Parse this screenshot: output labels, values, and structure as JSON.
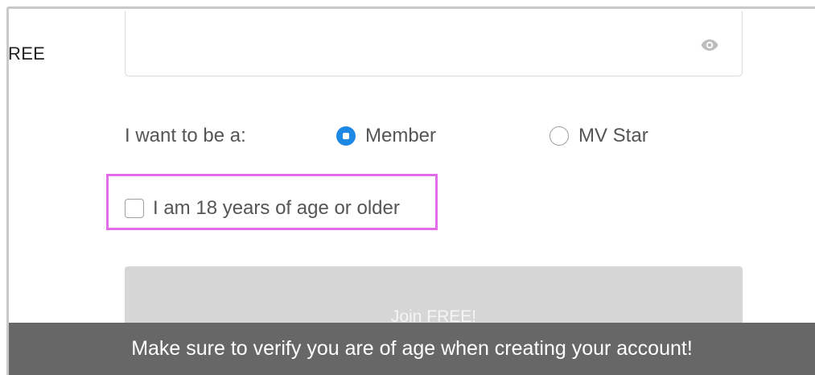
{
  "side_label": "REE",
  "password": {
    "value": "",
    "visibility_icon": "eye-icon"
  },
  "role": {
    "label": "I want to be a:",
    "options": [
      {
        "label": "Member",
        "selected": true
      },
      {
        "label": "MV Star",
        "selected": false
      }
    ]
  },
  "age_confirm": {
    "label": "I am 18 years of age or older",
    "checked": false,
    "highlight_color": "#e36de8"
  },
  "join_button": {
    "label": "Join FREE!",
    "enabled": false
  },
  "caption": "Make sure to verify you are of age when creating your account!",
  "colors": {
    "accent": "#1e88e5",
    "highlight": "#e36de8",
    "caption_bg": "#676767",
    "button_disabled": "#d6d6d6"
  }
}
